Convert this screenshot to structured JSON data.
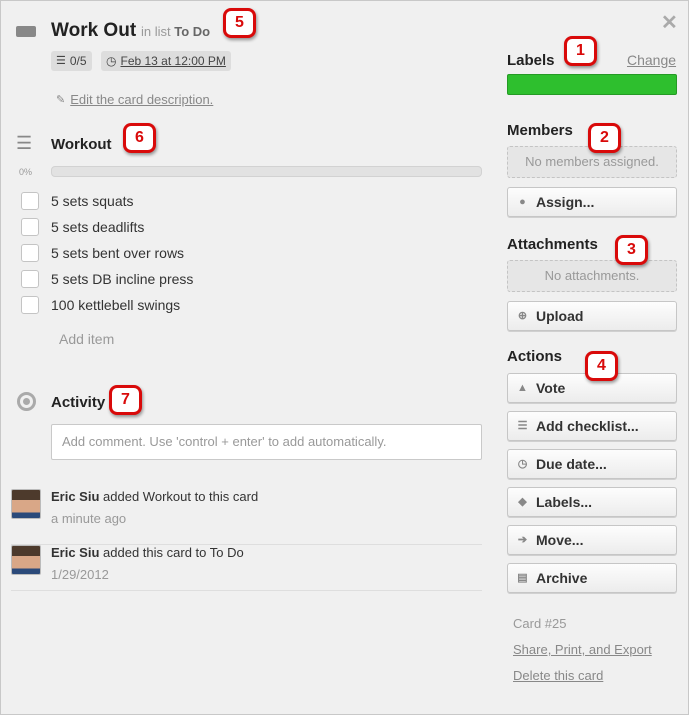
{
  "card": {
    "title": "Work Out",
    "in_list_prefix": "in list",
    "list_name": "To Do",
    "checklist_badge": "0/5",
    "due_badge": "Feb 13 at 12:00 PM",
    "edit_description": "Edit the card description."
  },
  "checklist": {
    "title": "Workout",
    "progress_label": "0%",
    "progress": 0,
    "items": [
      {
        "label": "5 sets squats"
      },
      {
        "label": "5 sets deadlifts"
      },
      {
        "label": "5 sets bent over rows"
      },
      {
        "label": "5 sets DB incline press"
      },
      {
        "label": "100 kettlebell swings"
      }
    ],
    "add_item": "Add item"
  },
  "activity": {
    "title": "Activity",
    "comment_placeholder": "Add comment. Use 'control + enter' to add automatically.",
    "entries": [
      {
        "user": "Eric Siu",
        "text": "added Workout to this card",
        "time": "a minute ago"
      },
      {
        "user": "Eric Siu",
        "text": "added this card to To Do",
        "time": "1/29/2012"
      }
    ]
  },
  "sidebar": {
    "labels_title": "Labels",
    "labels_change": "Change",
    "label_color": "#2ebf2e",
    "members_title": "Members",
    "members_empty": "No members assigned.",
    "assign_button": "Assign...",
    "attachments_title": "Attachments",
    "attachments_empty": "No attachments.",
    "upload_button": "Upload",
    "actions_title": "Actions",
    "actions": [
      {
        "label": "Vote",
        "icon": "thumbs-up-icon"
      },
      {
        "label": "Add checklist...",
        "icon": "checklist-icon"
      },
      {
        "label": "Due date...",
        "icon": "clock-icon"
      },
      {
        "label": "Labels...",
        "icon": "tag-icon"
      },
      {
        "label": "Move...",
        "icon": "arrow-right-icon"
      },
      {
        "label": "Archive",
        "icon": "archive-icon"
      }
    ],
    "card_number": "Card #25",
    "share_link": "Share, Print, and Export",
    "delete_link": "Delete this card"
  },
  "markers": [
    "1",
    "2",
    "3",
    "4",
    "5",
    "6",
    "7"
  ],
  "colors": {
    "marker": "#d90a0a",
    "progress": "#5ba94e"
  }
}
